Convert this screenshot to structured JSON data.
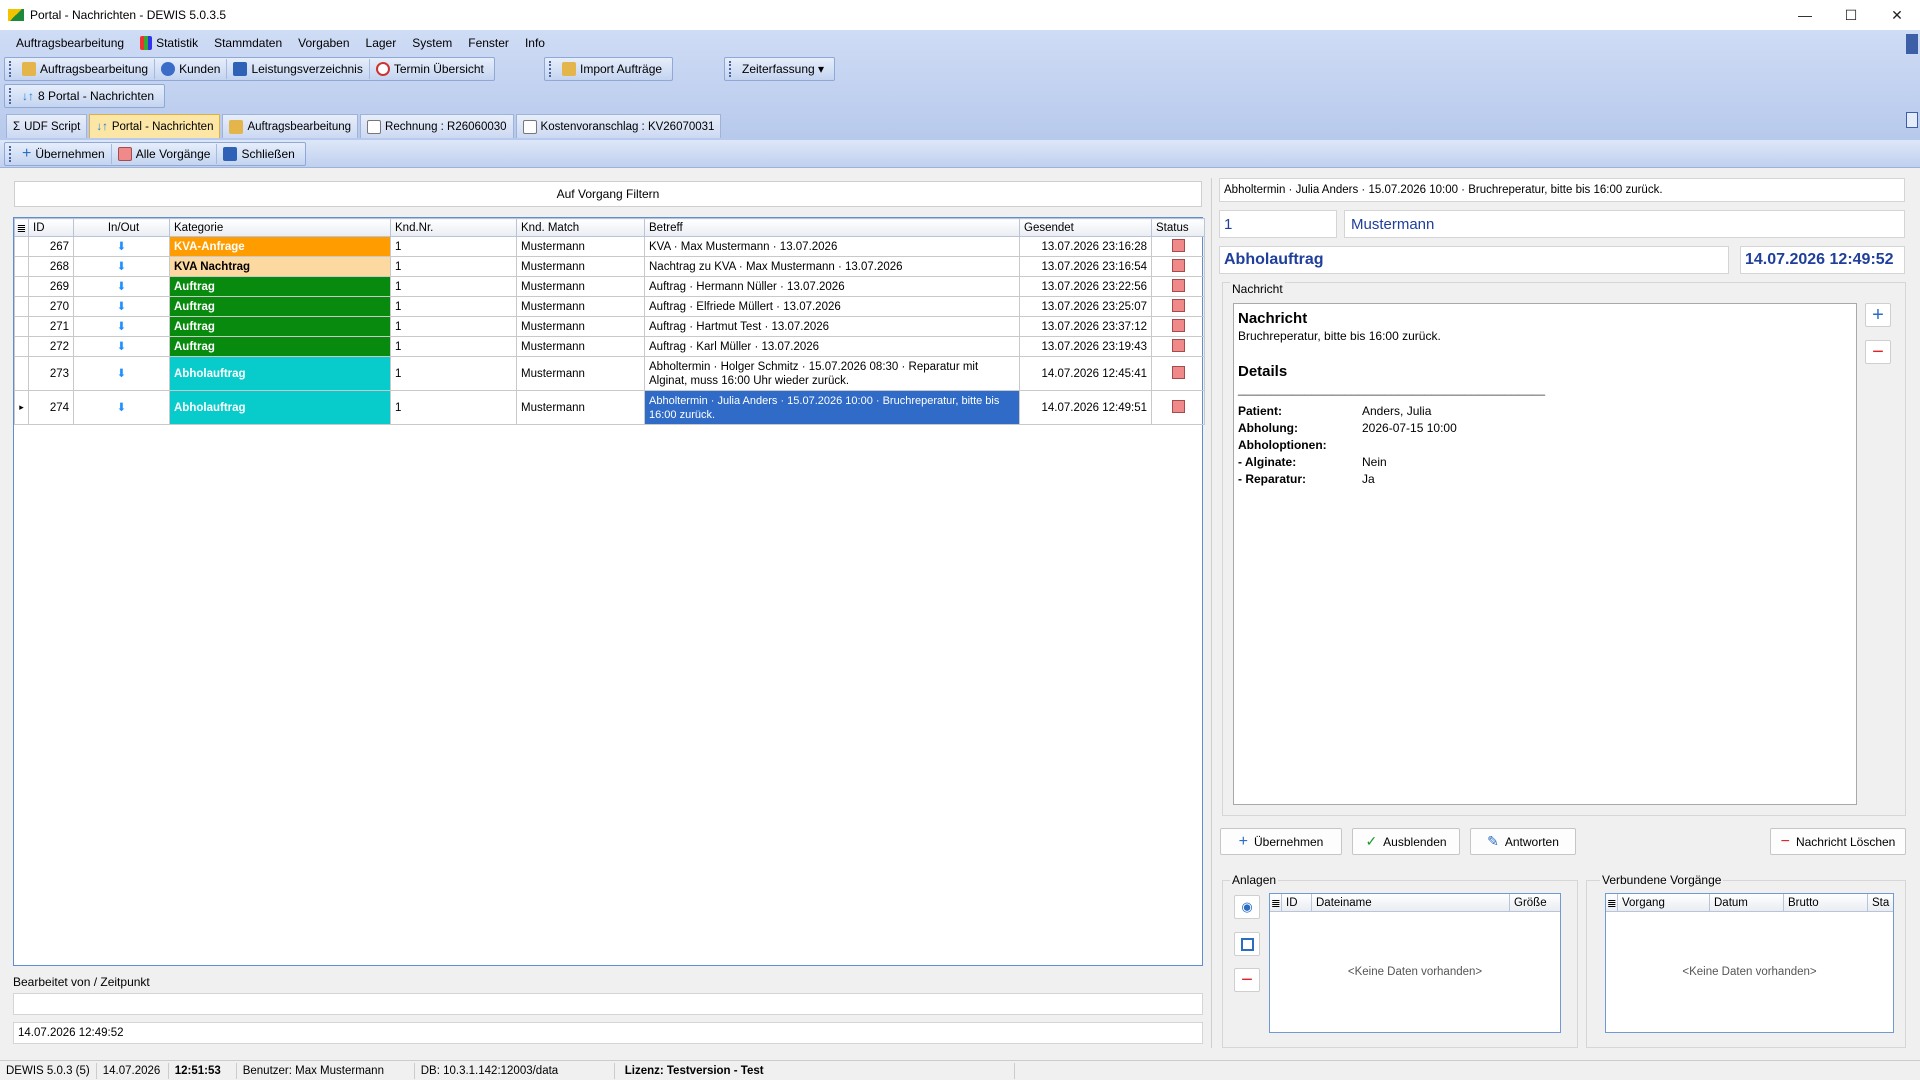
{
  "window": {
    "title": "Portal - Nachrichten - DEWIS 5.0.3.5",
    "minimize": "—",
    "maximize": "☐",
    "close": "✕"
  },
  "menu": [
    "Auftragsbearbeitung",
    "Statistik",
    "Stammdaten",
    "Vorgaben",
    "Lager",
    "System",
    "Fenster",
    "Info"
  ],
  "toolbar1": {
    "items": [
      "Auftragsbearbeitung",
      "Kunden",
      "Leistungsverzeichnis",
      "Termin Übersicht"
    ],
    "import": "Import Aufträge",
    "zeit": "Zeiterfassung ▾"
  },
  "toolbar2": {
    "window_item": "8 Portal - Nachrichten"
  },
  "tabs": [
    "UDF Script",
    "Portal - Nachrichten",
    "Auftragsbearbeitung",
    "Rechnung : R26060030",
    "Kostenvoranschlag : KV26070031"
  ],
  "actions": [
    "Übernehmen",
    "Alle Vorgänge",
    "Schließen"
  ],
  "filter": {
    "label": "Auf Vorgang Filtern"
  },
  "grid": {
    "columns": [
      "ID",
      "In/Out",
      "Kategorie",
      "Knd.Nr.",
      "Knd. Match",
      "Betreff",
      "Gesendet",
      "Status"
    ],
    "rows": [
      {
        "id": "267",
        "cat": "KVA-Anfrage",
        "catColor": "#ff9d00",
        "catText": "#ffffff",
        "knd": "1",
        "match": "Mustermann",
        "betreff": "KVA · Max Mustermann · 13.07.2026",
        "sent": "13.07.2026 23:16:28"
      },
      {
        "id": "268",
        "cat": "KVA Nachtrag",
        "catColor": "#fcd9a0",
        "catText": "#000000",
        "knd": "1",
        "match": "Mustermann",
        "betreff": "Nachtrag zu KVA · Max Mustermann · 13.07.2026",
        "sent": "13.07.2026 23:16:54"
      },
      {
        "id": "269",
        "cat": "Auftrag",
        "catColor": "#078a0e",
        "catText": "#ffffff",
        "knd": "1",
        "match": "Mustermann",
        "betreff": "Auftrag · Hermann Nüller · 13.07.2026",
        "sent": "13.07.2026 23:22:56"
      },
      {
        "id": "270",
        "cat": "Auftrag",
        "catColor": "#078a0e",
        "catText": "#ffffff",
        "knd": "1",
        "match": "Mustermann",
        "betreff": "Auftrag · Elfriede Müllert · 13.07.2026",
        "sent": "13.07.2026 23:25:07"
      },
      {
        "id": "271",
        "cat": "Auftrag",
        "catColor": "#078a0e",
        "catText": "#ffffff",
        "knd": "1",
        "match": "Mustermann",
        "betreff": "Auftrag · Hartmut Test · 13.07.2026",
        "sent": "13.07.2026 23:37:12"
      },
      {
        "id": "272",
        "cat": "Auftrag",
        "catColor": "#078a0e",
        "catText": "#ffffff",
        "knd": "1",
        "match": "Mustermann",
        "betreff": "Auftrag · Karl Müller · 13.07.2026",
        "sent": "13.07.2026 23:19:43"
      },
      {
        "id": "273",
        "cat": "Abholauftrag",
        "catColor": "#08cccc",
        "catText": "#ffffff",
        "knd": "1",
        "match": "Mustermann",
        "betreff": "Abholtermin · Holger Schmitz · 15.07.2026 08:30 · Reparatur mit Alginat, muss 16:00 Uhr wieder zurück.",
        "sent": "14.07.2026 12:45:41"
      },
      {
        "id": "274",
        "cat": "Abholauftrag",
        "catColor": "#08cccc",
        "catText": "#ffffff",
        "knd": "1",
        "match": "Mustermann",
        "betreff": "Abholtermin · Julia Anders · 15.07.2026 10:00 · Bruchreperatur, bitte bis 16:00 zurück.",
        "sent": "14.07.2026 12:49:51"
      }
    ]
  },
  "edited": {
    "label": "Bearbeitet von / Zeitpunkt",
    "user": "",
    "time": "14.07.2026 12:49:52"
  },
  "detail": {
    "subject": "Abholtermin · Julia Anders · 15.07.2026 10:00 · Bruchreperatur, bitte bis 16:00 zurück.",
    "kndnr": "1",
    "kndname": "Mustermann",
    "category": "Abholauftrag",
    "datetime": "14.07.2026 12:49:52",
    "group": "Nachricht",
    "msg": {
      "h1": "Nachricht",
      "body": "Bruchreperatur, bitte bis 16:00 zurück.",
      "h2": "Details",
      "rule": "______________________________________________",
      "rows": [
        [
          "Patient:",
          "Anders, Julia"
        ],
        [
          "Abholung:",
          "2026-07-15 10:00"
        ],
        [
          "Abholoptionen:",
          ""
        ],
        [
          "- Alginate:",
          "Nein"
        ],
        [
          "- Reparatur:",
          "Ja"
        ]
      ]
    },
    "buttons": {
      "take": "Übernehmen",
      "hide": "Ausblenden",
      "reply": "Antworten",
      "delete": "Nachricht Löschen"
    }
  },
  "anlagen": {
    "label": "Anlagen",
    "cols": [
      "ID",
      "Dateiname",
      "Größe"
    ],
    "empty": "<Keine Daten vorhanden>"
  },
  "vorgaenge": {
    "label": "Verbundene Vorgänge",
    "cols": [
      "Vorgang",
      "Datum",
      "Brutto",
      "Sta"
    ],
    "empty": "<Keine Daten vorhanden>"
  },
  "statusbar": {
    "ver": "DEWIS 5.0.3 (5)",
    "date": "14.07.2026",
    "time": "12:51:53",
    "user": "Benutzer: Max Mustermann",
    "db": "DB: 10.3.1.142:12003/data",
    "lic": "Lizenz: Testversion - Test"
  }
}
